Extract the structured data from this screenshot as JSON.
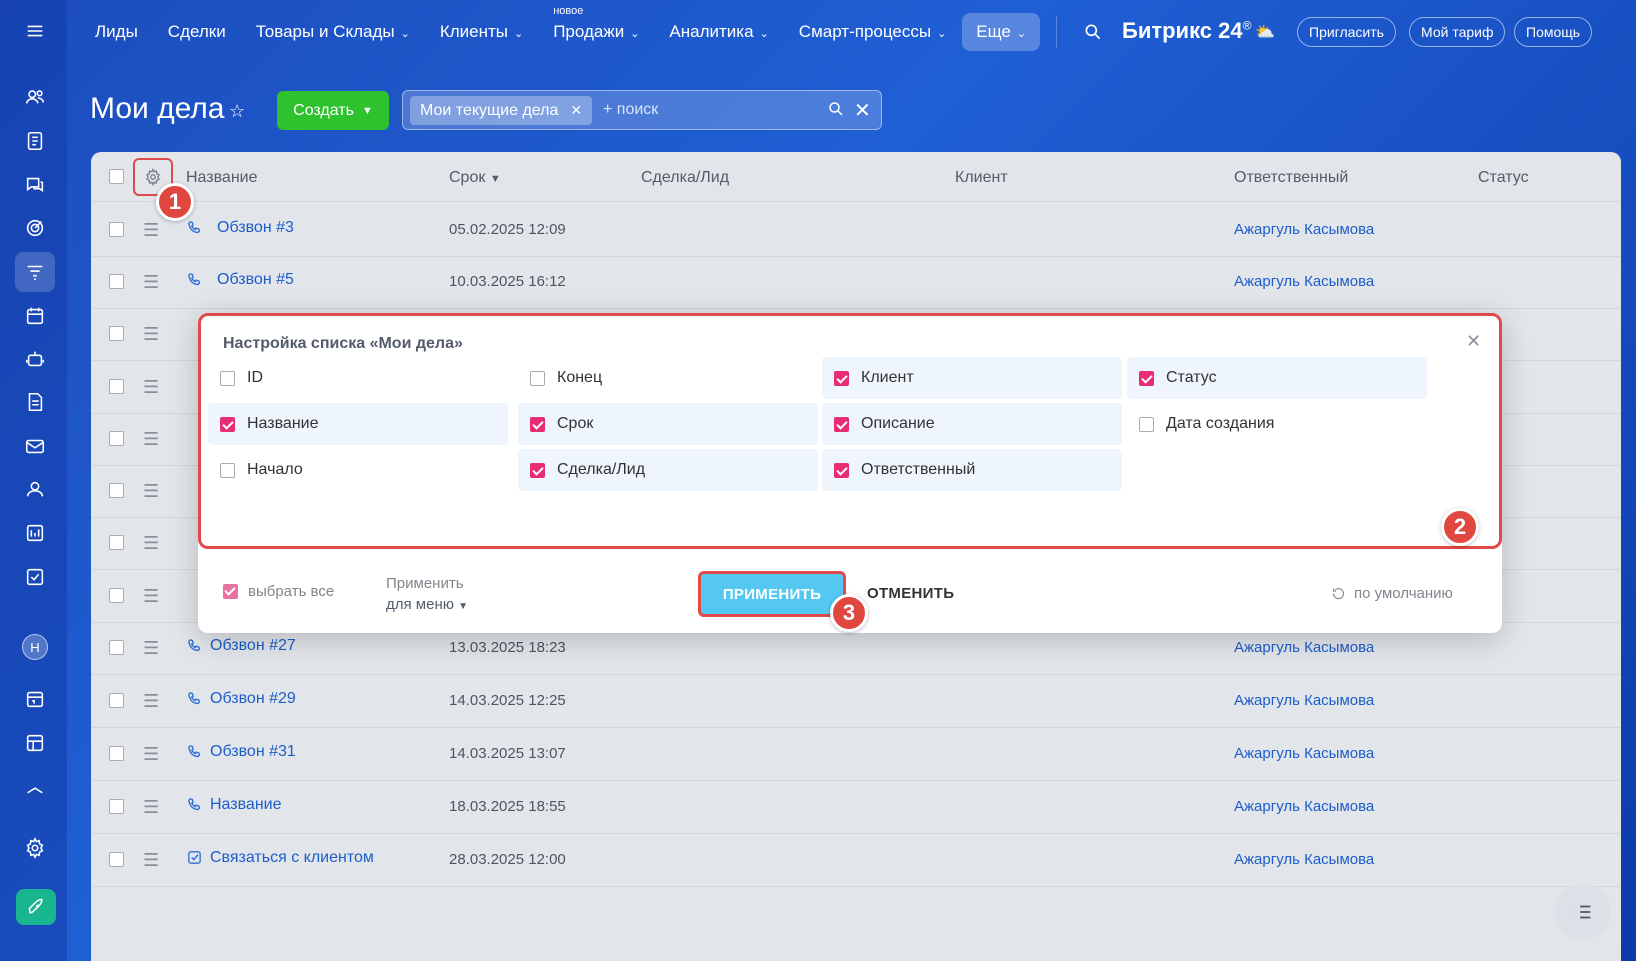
{
  "nav": {
    "items": [
      {
        "label": "Лиды",
        "chevron": false
      },
      {
        "label": "Сделки",
        "chevron": false
      },
      {
        "label": "Товары и Склады",
        "chevron": true
      },
      {
        "label": "Клиенты",
        "chevron": true
      },
      {
        "label": "Продажи",
        "chevron": true,
        "badge": "новое"
      },
      {
        "label": "Аналитика",
        "chevron": true
      },
      {
        "label": "Смарт-процессы",
        "chevron": true
      }
    ],
    "more_label": "Еще",
    "brand": "Битрикс 24",
    "brand_sup": "®",
    "invite": "Пригласить",
    "tariff": "Мой тариф",
    "help": "Помощь"
  },
  "page": {
    "title": "Мои дела",
    "create_label": "Создать",
    "filter_tag": "Мои текущие дела",
    "search_placeholder": "+ поиск"
  },
  "table": {
    "columns": {
      "name": "Название",
      "deadline": "Срок",
      "deal": "Сделка/Лид",
      "client": "Клиент",
      "responsible": "Ответственный",
      "status": "Статус"
    },
    "rows": [
      {
        "name": "Обзвон #3",
        "date": "05.02.2025 12:09",
        "responsible": "Ажаргуль Касымова",
        "icon": "phone-incoming-icon"
      },
      {
        "name": "Обзвон #5",
        "date": "10.03.2025 16:12",
        "responsible": "Ажаргуль Касымова",
        "icon": "phone-outgoing-icon"
      },
      {
        "name": "Обзвон #27",
        "date": "13.03.2025 18:23",
        "responsible": "Ажаргуль Касымова",
        "icon": "phone-outgoing-icon"
      },
      {
        "name": "Обзвон #29",
        "date": "14.03.2025 12:25",
        "responsible": "Ажаргуль Касымова",
        "icon": "phone-outgoing-icon"
      },
      {
        "name": "Обзвон #31",
        "date": "14.03.2025 13:07",
        "responsible": "Ажаргуль Касымова",
        "icon": "phone-outgoing-icon"
      },
      {
        "name": "Название",
        "date": "18.03.2025 18:55",
        "responsible": "Ажаргуль Касымова",
        "icon": "phone-outgoing-icon"
      },
      {
        "name": "Связаться с клиентом",
        "date": "28.03.2025 12:00",
        "responsible": "Ажаргуль Касымова",
        "icon": "task-check-icon"
      }
    ]
  },
  "dialog": {
    "title": "Настройка списка «Мои дела»",
    "options": [
      {
        "label": "ID",
        "checked": false
      },
      {
        "label": "Конец",
        "checked": false
      },
      {
        "label": "Клиент",
        "checked": true
      },
      {
        "label": "Статус",
        "checked": true
      },
      {
        "label": "Название",
        "checked": true
      },
      {
        "label": "Срок",
        "checked": true
      },
      {
        "label": "Описание",
        "checked": true
      },
      {
        "label": "Дата создания",
        "checked": false
      },
      {
        "label": "Начало",
        "checked": false
      },
      {
        "label": "Сделка/Лид",
        "checked": true
      },
      {
        "label": "Ответственный",
        "checked": true
      }
    ],
    "select_all": "выбрать все",
    "apply_for_line1": "Применить",
    "apply_for_line2": "для меню",
    "apply": "ПРИМЕНИТЬ",
    "cancel": "ОТМЕНИТЬ",
    "default": "по умолчанию"
  },
  "markers": [
    "1",
    "2",
    "3"
  ],
  "sidebar": {
    "avatar_letter": "Н",
    "icons": [
      "menu-icon",
      "users-icon",
      "crm-icon",
      "chat-icon",
      "target-icon",
      "funnel-icon",
      "calendar-icon",
      "robot-icon",
      "document-icon",
      "mail-icon",
      "contacts-icon",
      "bi-icon",
      "tasks-icon",
      "schedule-icon",
      "table-icon",
      "collapse-icon",
      "settings-icon",
      "rocket-icon"
    ]
  },
  "colors": {
    "accent_green": "#2fc22f",
    "highlight_red": "#e04a4a",
    "check_pink": "#e82d75",
    "apply_blue": "#55c8f1",
    "link_blue": "#1d5ec9"
  }
}
